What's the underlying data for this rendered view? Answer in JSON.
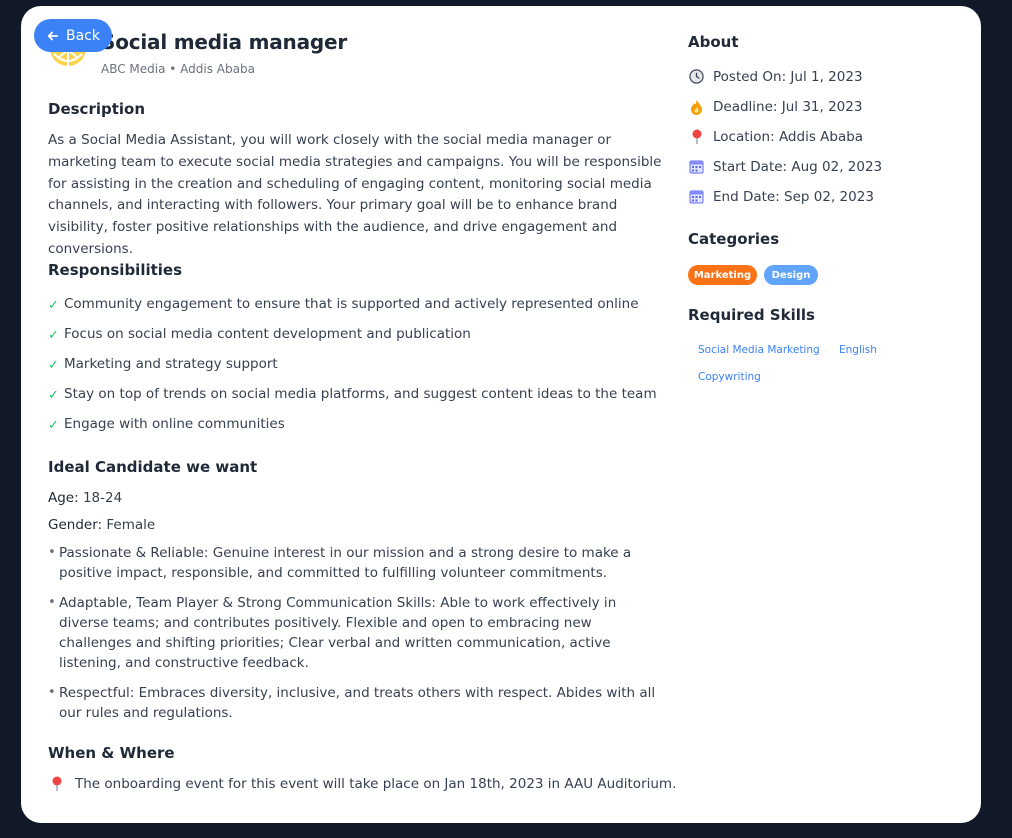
{
  "back": {
    "label": "Back"
  },
  "job": {
    "title": "Social media manager",
    "meta": "ABC Media • Addis Ababa"
  },
  "description": {
    "heading": "Description",
    "text": "As a Social Media Assistant, you will work closely with the social media manager or marketing team to execute social media strategies and campaigns. You will be responsible for assisting in the creation and scheduling of engaging content, monitoring social media channels, and interacting with followers. Your primary goal will be to enhance brand visibility, foster positive relationships with the audience, and drive engagement and conversions."
  },
  "responsibilities": {
    "heading": "Responsibilities",
    "items": [
      "Community engagement to ensure that is supported and actively represented online",
      "Focus on social media content development and publication",
      "Marketing and strategy support",
      "Stay on top of trends on social media platforms, and suggest content ideas to the team",
      "Engage with online communities"
    ]
  },
  "ideal": {
    "heading": "Ideal Candidate we want",
    "age_label": "Age:",
    "age_value": "18-24",
    "gender_label": "Gender:",
    "gender_value": "Female",
    "traits": [
      "Passionate & Reliable: Genuine interest in our mission and a strong desire to make a positive impact, responsible, and committed to fulfilling volunteer commitments.",
      "Adaptable, Team Player & Strong Communication Skills: Able to work effectively in diverse teams; and contributes positively. Flexible and open to embracing new challenges and shifting priorities; Clear verbal and written communication, active listening, and constructive feedback.",
      "Respectful: Embraces diversity, inclusive, and treats others with respect. Abides with all our rules and regulations."
    ]
  },
  "when_where": {
    "heading": "When & Where",
    "text": "The onboarding event for this event will take place on Jan 18th, 2023 in AAU Auditorium."
  },
  "about": {
    "heading": "About",
    "posted_on": "Posted On: Jul 1, 2023",
    "deadline": "Deadline: Jul 31, 2023",
    "location": "Location: Addis Ababa",
    "start_date": "Start Date: Aug 02, 2023",
    "end_date": "End Date: Sep 02, 2023"
  },
  "categories": {
    "heading": "Categories",
    "items": [
      "Marketing",
      "Design"
    ]
  },
  "skills": {
    "heading": "Required Skills",
    "items": [
      "Social Media Marketing",
      "English",
      "Copywriting"
    ]
  },
  "colors": {
    "accent": "#3B82F6",
    "marketing_tag": "#F97316",
    "design_tag": "#60A5FA",
    "check": "#22C55E",
    "background": "#111827"
  },
  "icons": {
    "back": "arrow-left-icon",
    "posted_on": "clock-icon",
    "deadline": "fire-icon",
    "location": "pin-icon",
    "start_date": "calendar-icon",
    "end_date": "calendar-icon",
    "check": "check-icon",
    "where": "pin-icon"
  }
}
